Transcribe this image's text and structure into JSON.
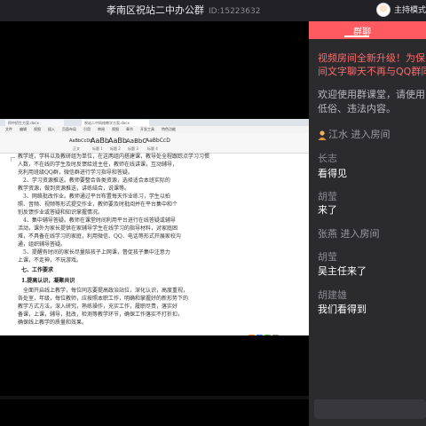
{
  "header": {
    "room_title": "孝南区祝站二中办公群",
    "room_id": "ID:15223632",
    "host_label": "主持模式"
  },
  "shared_screen": {
    "tabs": [
      "四中招生方案.docx",
      "祝站二中网络教学方案.docx"
    ],
    "menu": [
      "文件",
      "编辑",
      "视图",
      "插入",
      "页面布局",
      "引用",
      "审阅",
      "视图",
      "章节",
      "开发工具",
      "特色功能"
    ],
    "styles": [
      {
        "sample": "AaBbCcDd",
        "caption": "正文"
      },
      {
        "sample": "AaBb",
        "caption": "标题 1"
      },
      {
        "sample": "AaBb",
        "caption": "标题 2"
      },
      {
        "sample": "AaBbC",
        "caption": "标题 3"
      },
      {
        "sample": "AaBbCcD",
        "caption": "标题 4"
      }
    ],
    "lines": [
      "教学班，学科以及教研组为单位，在这两组内搭建课，教导处全程跟踪点学习习惯",
      "人数，不在线的学生及时反馈给班主任，教师在线讲课，互动辅导，",
      "充利用班级QQ群，微信群进行学习指导和答疑。",
      "2、学习资源推送。教师要整合各类资源，选择适合本班实际的",
      "教学资源，做到资源推送，讲练结合，说课等。",
      "3、网络批改作业。教师通过平台布置每天作业练习，学生以拍",
      "照、音频、视频等形式提交作业，教师要及时批阅并在平台集中和个",
      "别反馈作业或答疑和知识掌握情况。",
      "4、集中辅导答疑。教师在课堂时间利用平台进行在线答疑或辅导",
      "活动，课外为家长提供在家辅导学生在线学习的指导材料，对家庭困",
      "难，不具备在线学习的家庭，利用微信、QQ、电话等形式开展家校沟",
      "通，组织辅导答疑。",
      "5、提醒有时间的家长尽量陪孩子上网课，督促孩子集中注意力",
      "上课，不走神，不玩游戏。",
      "七、工作要求",
      "1.提高认识，凝聚共识",
      "全面开启线上教学，每位同志要提高政治站位，深化认识，高度重视，",
      "各处室，年级，每位教师，应按照本职工作，明确和掌握好的新形势下的",
      "教学方式方法，深入研究，熟练操作，充实工作，履职尽责，落实好",
      "备课，上课，辅导，批改，检测等教学环节，确保工作落实不打折扣，",
      "确保线上教学的质量和效果。"
    ]
  },
  "chat": {
    "tab_label": "群聊",
    "announcement": [
      "视频房间全新升级！为保",
      "间文字聊天不再与QQ群同"
    ],
    "welcome": [
      "欢迎使用群课堂，请使用",
      "低俗、违法内容。"
    ],
    "join_event_1": "江水 进入房间",
    "messages": [
      {
        "sender": "长志",
        "text": "看得见"
      },
      {
        "sender": "胡莹",
        "text": "来了"
      }
    ],
    "join_event_2": "张燕 进入房间",
    "messages_2": [
      {
        "sender": "胡莹",
        "text": "吴主任来了"
      },
      {
        "sender": "胡建雄",
        "text": "我们看得到"
      }
    ]
  },
  "colors": {
    "accent": "#ff5a5f",
    "panel_bg": "#2b2b2e",
    "announcement": "#ff6a6a"
  }
}
